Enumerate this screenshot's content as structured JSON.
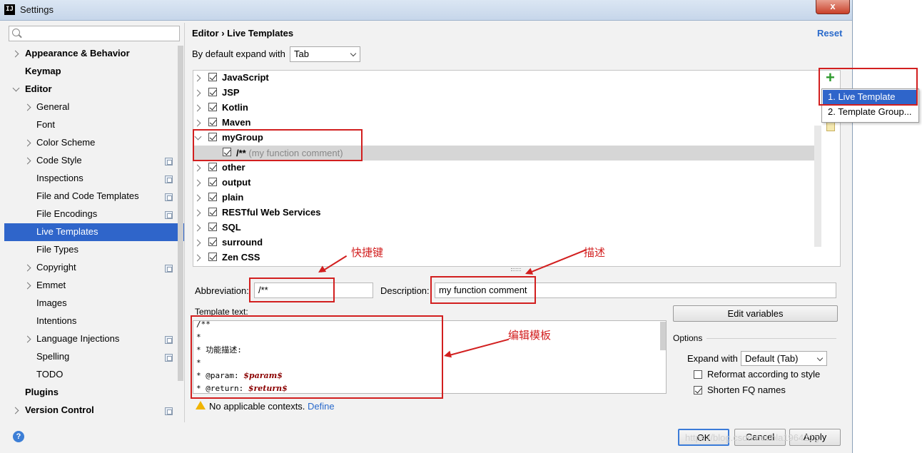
{
  "window": {
    "title": "Settings",
    "app_icon": "IJ",
    "close_label": "x"
  },
  "search": {
    "placeholder": ""
  },
  "sidebar": {
    "items": [
      {
        "label": "Appearance & Behavior"
      },
      {
        "label": "Keymap"
      },
      {
        "label": "Editor"
      },
      {
        "label": "General"
      },
      {
        "label": "Font"
      },
      {
        "label": "Color Scheme"
      },
      {
        "label": "Code Style"
      },
      {
        "label": "Inspections"
      },
      {
        "label": "File and Code Templates"
      },
      {
        "label": "File Encodings"
      },
      {
        "label": "Live Templates"
      },
      {
        "label": "File Types"
      },
      {
        "label": "Copyright"
      },
      {
        "label": "Emmet"
      },
      {
        "label": "Images"
      },
      {
        "label": "Intentions"
      },
      {
        "label": "Language Injections"
      },
      {
        "label": "Spelling"
      },
      {
        "label": "TODO"
      },
      {
        "label": "Plugins"
      },
      {
        "label": "Version Control"
      }
    ]
  },
  "header": {
    "crumb_parent": "Editor",
    "crumb_sep": "›",
    "crumb_current": "Live Templates",
    "reset_label": "Reset"
  },
  "expand": {
    "label": "By default expand with",
    "value": "Tab"
  },
  "groups": [
    {
      "name": "JavaScript"
    },
    {
      "name": "JSP"
    },
    {
      "name": "Kotlin"
    },
    {
      "name": "Maven"
    },
    {
      "name": "myGroup"
    },
    {
      "name": "other"
    },
    {
      "name": "output"
    },
    {
      "name": "plain"
    },
    {
      "name": "RESTful Web Services"
    },
    {
      "name": "SQL"
    },
    {
      "name": "surround"
    },
    {
      "name": "Zen CSS"
    }
  ],
  "template_item": {
    "abbr": "/**",
    "desc": "(my function comment)"
  },
  "popup": {
    "item1": "1. Live Template",
    "item2": "2. Template Group..."
  },
  "annotations": {
    "shortcut": "快捷键",
    "description": "描述",
    "edit_template": "编辑模板"
  },
  "form": {
    "abbreviation_label": "Abbreviation:",
    "abbreviation_value": "/**",
    "description_label": "Description:",
    "description_value": "my function comment",
    "template_text_label": "Template text:",
    "edit_variables_label": "Edit variables",
    "options_label": "Options",
    "expand_with_label": "Expand with",
    "expand_with_value": "Default (Tab)",
    "reformat_label": "Reformat according to style",
    "shorten_label": "Shorten FQ names"
  },
  "template_text": {
    "l1": "/**",
    "l2": " *",
    "l3": " * 功能描述:",
    "l4": " *",
    "l5a": " * @param: ",
    "l5b": "$param$",
    "l6a": " * @return: ",
    "l6b": "$return$"
  },
  "context": {
    "warning": "No applicable contexts.",
    "define": "Define"
  },
  "footer": {
    "ok": "OK",
    "cancel": "Cancel",
    "apply": "Apply"
  },
  "watermark": "https://blog.csdn.net/bla196421g"
}
